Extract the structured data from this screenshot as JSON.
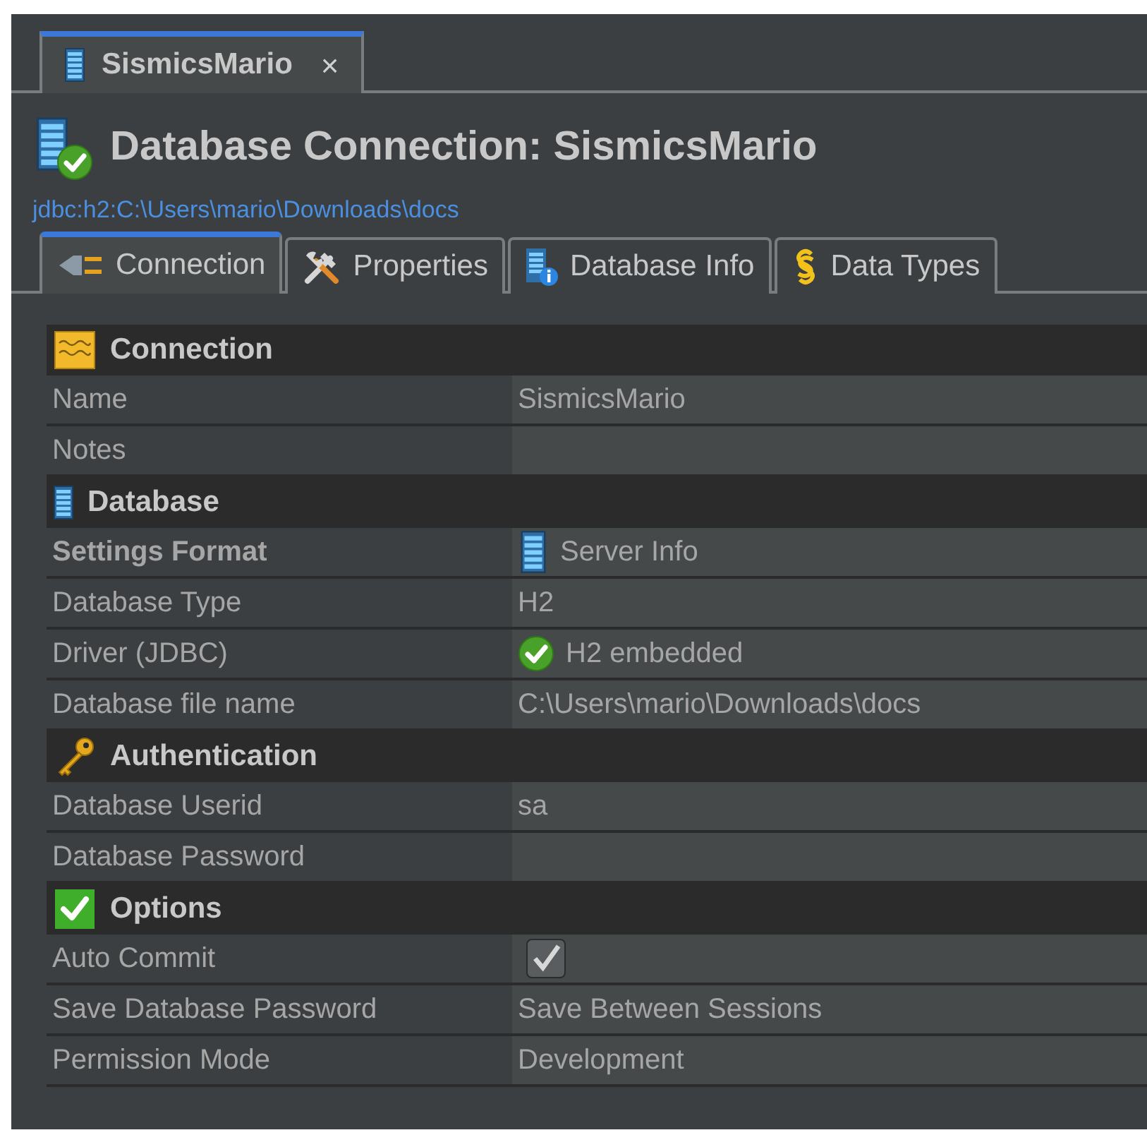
{
  "editor_tab": {
    "title": "SismicsMario",
    "close": "×",
    "selected": true
  },
  "header": {
    "title": "Database Connection: SismicsMario",
    "url": "jdbc:h2:C:\\Users\\mario\\Downloads\\docs"
  },
  "tabs": [
    {
      "label": "Connection",
      "selected": true
    },
    {
      "label": "Properties",
      "selected": false
    },
    {
      "label": "Database Info",
      "selected": false
    },
    {
      "label": "Data Types",
      "selected": false
    }
  ],
  "sections": [
    {
      "title": "Connection",
      "rows": [
        {
          "kind": "text",
          "label": "Name",
          "value": "SismicsMario",
          "bold": false
        },
        {
          "kind": "text",
          "label": "Notes",
          "bold": false
        }
      ]
    },
    {
      "title": "Database",
      "rows": [
        {
          "kind": "text",
          "label": "Settings Format",
          "value": "Server Info",
          "bold": true
        },
        {
          "kind": "text",
          "label": "Database Type",
          "value": "H2",
          "bold": false
        },
        {
          "kind": "text",
          "label": "Driver (JDBC)",
          "value": "H2 embedded",
          "bold": false
        },
        {
          "kind": "text",
          "label": "Database file name",
          "value": "C:\\Users\\mario\\Downloads\\docs",
          "bold": false
        }
      ]
    },
    {
      "title": "Authentication",
      "rows": [
        {
          "kind": "text",
          "label": "Database Userid",
          "value": "sa",
          "bold": false
        },
        {
          "kind": "text",
          "label": "Database Password",
          "bold": false
        }
      ]
    },
    {
      "title": "Options",
      "rows": [
        {
          "kind": "checkbox",
          "label": "Auto Commit",
          "checked": true,
          "bold": false
        },
        {
          "kind": "text",
          "label": "Save Database Password",
          "value": "Save Between Sessions",
          "bold": false
        },
        {
          "kind": "text",
          "label": "Permission Mode",
          "value": "Development",
          "bold": false
        }
      ]
    }
  ]
}
